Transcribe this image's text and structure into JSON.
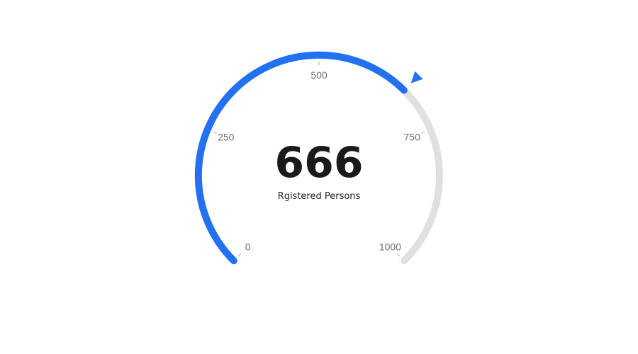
{
  "chart_data": {
    "type": "gauge",
    "value": 666,
    "min": 0,
    "max": 1000,
    "value_label": "666",
    "caption": "Rgistered Persons",
    "ticks": [
      {
        "value": 0,
        "label": "0"
      },
      {
        "value": 250,
        "label": "250"
      },
      {
        "value": 500,
        "label": "500"
      },
      {
        "value": 750,
        "label": "750"
      },
      {
        "value": 1000,
        "label": "1000"
      }
    ],
    "colors": {
      "progress": "#2271f0",
      "track": "#e0e0e0",
      "pointer": "#2271f0",
      "tick_label": "#6e6e6e"
    }
  }
}
